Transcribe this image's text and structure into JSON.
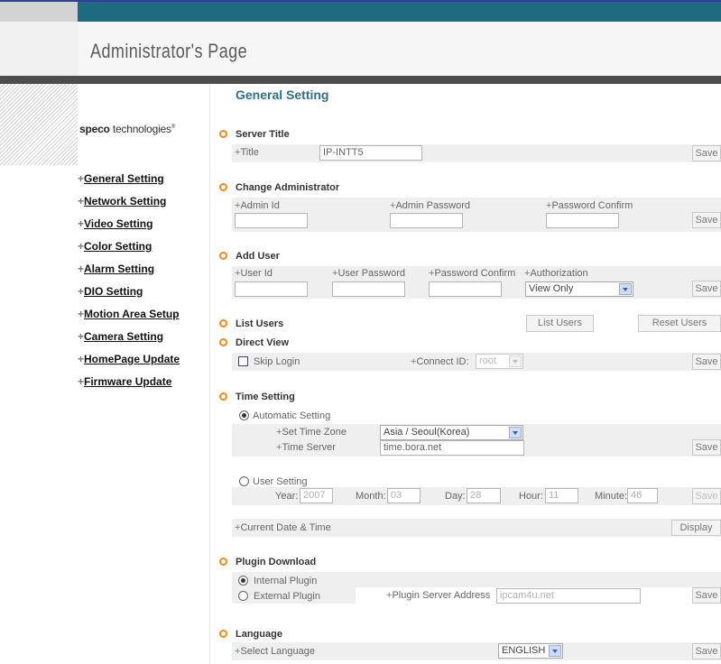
{
  "header": {
    "title": "Administrator's Page"
  },
  "logo": {
    "brand": "speco",
    "rest": "technologies"
  },
  "nav": [
    "General Setting",
    "Network Setting",
    "Video Setting",
    "Color Setting",
    "Alarm Setting",
    "DIO Setting",
    "Motion Area Setup",
    "Camera Setting",
    "HomePage Update",
    "Firmware Update"
  ],
  "page_title": "General Setting",
  "server_title": {
    "heading": "Server Title",
    "title_label": "Title",
    "title_value": "IP-INTT5",
    "save": "Save"
  },
  "change_admin": {
    "heading": "Change Administrator",
    "admin_id_label": "Admin Id",
    "admin_password_label": "Admin Password",
    "password_confirm_label": "Password Confirm",
    "save": "Save"
  },
  "add_user": {
    "heading": "Add User",
    "user_id_label": "User Id",
    "user_password_label": "User Password",
    "password_confirm_label": "Password Confirm",
    "authorization_label": "Authorization",
    "authorization_value": "View Only",
    "save": "Save"
  },
  "list_users": {
    "heading": "List Users",
    "list_button": "List Users",
    "reset_button": "Reset Users"
  },
  "direct_view": {
    "heading": "Direct View",
    "skip_login": "Skip Login",
    "connect_id_label": "Connect ID:",
    "connect_id_value": "root",
    "save": "Save"
  },
  "time_setting": {
    "heading": "Time Setting",
    "automatic": "Automatic Setting",
    "time_zone_label": "Set Time Zone",
    "time_zone_value": "Asia / Seoul(Korea)",
    "time_server_label": "Time Server",
    "time_server_value": "time.bora.net",
    "save_auto": "Save",
    "user_setting": "User Setting",
    "year_label": "Year:",
    "year_value": "2007",
    "month_label": "Month:",
    "month_value": "03",
    "day_label": "Day:",
    "day_value": "28",
    "hour_label": "Hour:",
    "hour_value": "11",
    "minute_label": "Minute:",
    "minute_value": "46",
    "save_user": "Save",
    "current_label": "Current Date & Time",
    "display_button": "Display"
  },
  "plugin": {
    "heading": "Plugin Download",
    "internal": "Internal Plugin",
    "external": "External Plugin",
    "server_address_label": "Plugin Server Address",
    "server_address_value": "ipcam4u.net",
    "save": "Save"
  },
  "language": {
    "heading": "Language",
    "select_label": "Select Language",
    "value": "ENGLISH",
    "save": "Save"
  },
  "colors": {
    "accent": "#1f6b7e",
    "bullet": "#f08a1b",
    "title": "#2e6f8a"
  }
}
